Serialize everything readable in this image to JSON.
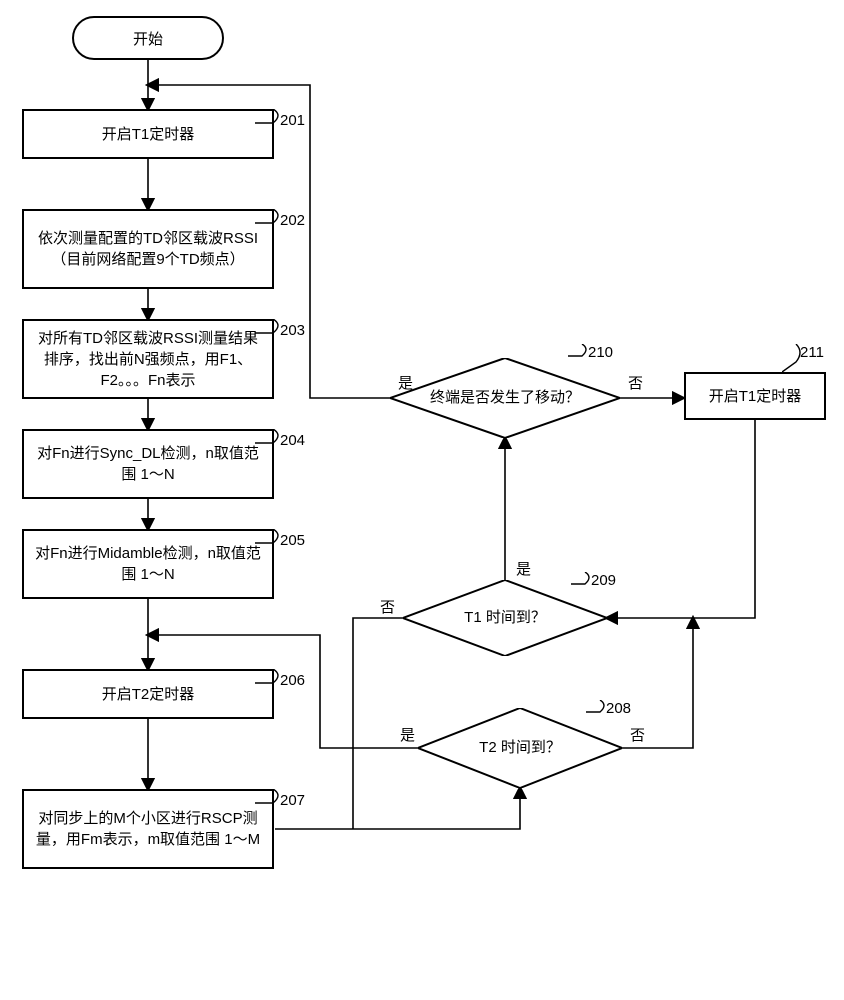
{
  "start": "开始",
  "step201": {
    "num": "201",
    "text": "开启T1定时器"
  },
  "step202": {
    "num": "202",
    "text": "依次测量配置的TD邻区载波RSSI（目前网络配置9个TD频点）"
  },
  "step203": {
    "num": "203",
    "text": "对所有TD邻区载波RSSI测量结果排序，找出前N强频点，用F1、F2。。。Fn表示"
  },
  "step204": {
    "num": "204",
    "text": "对Fn进行Sync_DL检测，n取值范围 1～N"
  },
  "step205": {
    "num": "205",
    "text": "对Fn进行Midamble检测，n取值范围 1～N"
  },
  "step206": {
    "num": "206",
    "text": "开启T2定时器"
  },
  "step207": {
    "num": "207",
    "text": "对同步上的M个小区进行RSCP测量，用Fm表示，m取值范围 1～M"
  },
  "step208": {
    "num": "208",
    "text": "T2 时间到？"
  },
  "step209": {
    "num": "209",
    "text": "T1 时间到？"
  },
  "step210": {
    "num": "210",
    "text": "终端是否发生了移动？"
  },
  "step211": {
    "num": "211",
    "text": "开启T1定时器"
  },
  "labels": {
    "yes": "是",
    "no": "否"
  }
}
